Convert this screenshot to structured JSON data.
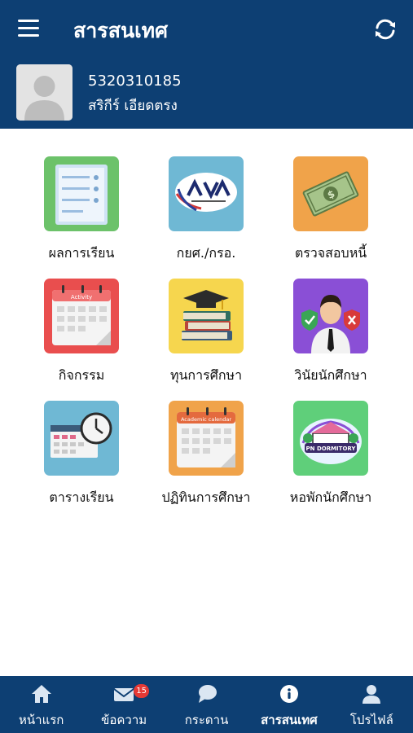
{
  "header": {
    "title": "สารสนเทศ",
    "student_id": "5320310185",
    "student_name": "สริกีร์ เอียดตรง"
  },
  "menu": [
    {
      "label": "ผลการเรียน",
      "icon": "grade-report-icon",
      "bg": "#6cc26a"
    },
    {
      "label": "กยศ./กรอ.",
      "icon": "student-loan-fund-icon",
      "bg": "#6fb8d4"
    },
    {
      "label": "ตรวจสอบหนี้",
      "icon": "money-check-icon",
      "bg": "#f0a34a"
    },
    {
      "label": "กิจกรรม",
      "icon": "activity-calendar-icon",
      "bg": "#e94e4e",
      "icon_text": "Activity"
    },
    {
      "label": "ทุนการศึกษา",
      "icon": "scholarship-books-icon",
      "bg": "#f6d64e"
    },
    {
      "label": "วินัยนักศึกษา",
      "icon": "student-discipline-icon",
      "bg": "#8a4fd6"
    },
    {
      "label": "ตารางเรียน",
      "icon": "class-schedule-icon",
      "bg": "#6fb8d4"
    },
    {
      "label": "ปฏิทินการศึกษา",
      "icon": "academic-calendar-icon",
      "bg": "#f0a34a",
      "icon_text": "Academic calendar"
    },
    {
      "label": "หอพักนักศึกษา",
      "icon": "dormitory-icon",
      "bg": "#5fcf7a",
      "icon_text": "PN DORMITORY"
    }
  ],
  "bottom_nav": [
    {
      "label": "หน้าแรก",
      "icon": "home-icon"
    },
    {
      "label": "ข้อความ",
      "icon": "mail-icon",
      "badge": "15"
    },
    {
      "label": "กระดาน",
      "icon": "chat-bubble-icon"
    },
    {
      "label": "สารสนเทศ",
      "icon": "info-icon",
      "active": true
    },
    {
      "label": "โปรไฟล์",
      "icon": "profile-icon"
    }
  ]
}
